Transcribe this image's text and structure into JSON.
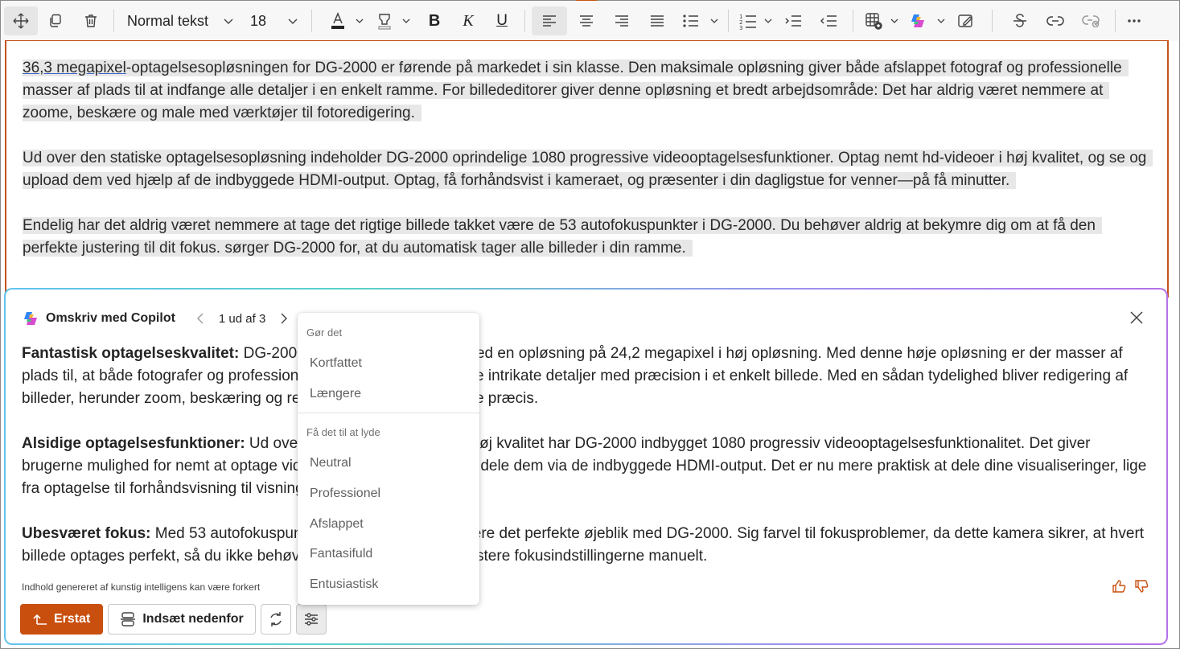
{
  "toolbar": {
    "style_label": "Normal tekst",
    "font_size": "18"
  },
  "document": {
    "para1_link": "36,3 megapixel",
    "para1_rest": "-optagelsesopløsningen for DG-2000 er førende på markedet i sin klasse. Den maksimale opløsning giver både afslappet fotograf og professionelle masser af plads til at indfange alle detaljer i en enkelt ramme. For billededitorer giver denne opløsning et bredt arbejdsområde: Det har aldrig været nemmere at zoome, beskære og male med værktøjer til fotoredigering.",
    "para2": "Ud over den statiske optagelsesopløsning indeholder DG-2000 oprindelige 1080 progressive videooptagelsesfunktioner. Optag nemt hd-videoer i høj kvalitet, og se og upload dem ved hjælp af de indbyggede HDMI-output. Optag, få forhåndsvist i kameraet, og præsenter i din dagligstue for venner—på få minutter.",
    "para3": "Endelig har det aldrig været nemmere at tage det rigtige billede takket være de 53 autofokuspunkter i DG-2000. Du behøver aldrig at bekymre dig om at få den perfekte justering til dit fokus. sørger DG-2000 for, at du automatisk tager alle billeder i din ramme."
  },
  "copilot": {
    "title": "Omskriv med Copilot",
    "pager": "1 ud af 3",
    "sections": [
      {
        "heading": "Fantastisk optagelseskvalitet:",
        "text": " DG-2000 er førende i sin klasse med en opløsning på 24,2 megapixel i høj opløsning. Med denne høje opløsning er der masser af plads til, at både fotografer og professionelle fotografer kan indfange intrikate detaljer med præcision i et enkelt billede. Med en sådan tydelighed bliver redigering af billeder, herunder zoom, beskæring og redigering nemmere og mere præcis."
      },
      {
        "heading": "Alsidige optagelsesfunktioner:",
        "text": " Ud over den statiske opløsning i høj kvalitet har DG-2000 indbygget 1080 progressiv videooptagelsesfunktionalitet. Det giver brugerne mulighed for nemt at optage videoer i høj kvalitet og nemt dele dem via de indbyggede HDMI-output. Det er nu mere praktisk at dele dine visualiseringer, lige fra optagelse til forhåndsvisning til visning."
      },
      {
        "heading": "Ubesværet fokus:",
        "text": " Med 53 autofokuspunkter er det nemt at registrere det perfekte øjeblik med DG-2000. Sig farvel til fokusproblemer, da dette kamera sikrer, at hvert billede optages perfekt, så du ikke behøver at bekymre dig om at justere fokusindstillingerne manuelt."
      }
    ],
    "disclaimer": "Indhold genereret af kunstig intelligens kan være forkert",
    "replace_label": "Erstat",
    "insert_label": "Indsæt nedenfor"
  },
  "menu": {
    "group1": "Gør det",
    "group1_items": [
      "Kortfattet",
      "Længere"
    ],
    "group2": "Få det til at lyde",
    "group2_items": [
      "Neutral",
      "Professionel",
      "Afslappet",
      "Fantasifuld",
      "Entusiastisk"
    ]
  },
  "colors": {
    "accent": "#c94f0f",
    "doc_border": "#c2541d"
  }
}
